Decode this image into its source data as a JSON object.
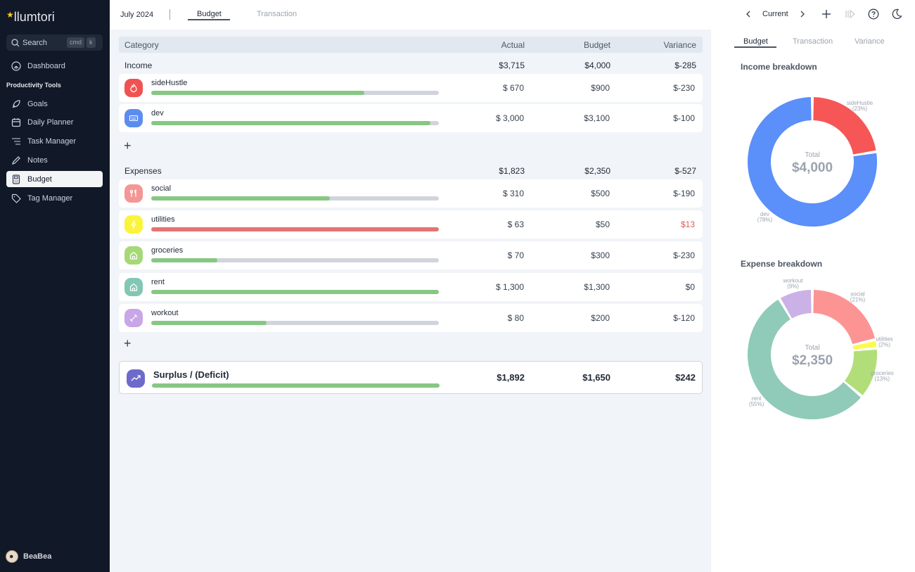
{
  "app": {
    "brand": "llumtori",
    "search": {
      "placeholder": "Search",
      "shortcut_mod": "cmd",
      "shortcut_key": "k"
    },
    "nav_top": [
      {
        "label": "Dashboard",
        "icon": "dashboard-icon"
      }
    ],
    "section_label": "Productivity Tools",
    "nav_items": [
      {
        "label": "Goals",
        "icon": "rocket-icon"
      },
      {
        "label": "Daily Planner",
        "icon": "calendar-icon"
      },
      {
        "label": "Task Manager",
        "icon": "list-icon"
      },
      {
        "label": "Notes",
        "icon": "pencil-icon"
      },
      {
        "label": "Budget",
        "icon": "calculator-icon",
        "active": true
      },
      {
        "label": "Tag Manager",
        "icon": "tag-icon"
      }
    ],
    "user": {
      "name": "BeaBea"
    }
  },
  "topbar": {
    "month": "July 2024",
    "tabs": [
      {
        "label": "Budget",
        "active": true
      },
      {
        "label": "Transaction",
        "active": false
      }
    ],
    "period": "Current",
    "icons": [
      "chevron-left-icon",
      "chevron-right-icon",
      "plus-icon",
      "panel-toggle-icon",
      "help-icon",
      "moon-icon"
    ]
  },
  "table": {
    "headers": {
      "category": "Category",
      "actual": "Actual",
      "budget": "Budget",
      "variance": "Variance"
    },
    "income": {
      "label": "Income",
      "actual": "$3,715",
      "budget": "$4,000",
      "variance": "$-285",
      "rows": [
        {
          "name": "sideHustle",
          "actual": "$ 670",
          "budget": "$900",
          "variance": "$-230",
          "progress": 0.74,
          "icon": "fire-icon",
          "color": "#f05252",
          "bar_color": "#86c784",
          "over": false
        },
        {
          "name": "dev",
          "actual": "$ 3,000",
          "budget": "$3,100",
          "variance": "$-100",
          "progress": 0.97,
          "icon": "keyboard-icon",
          "color": "#5b8def",
          "bar_color": "#86c784",
          "over": false
        }
      ]
    },
    "expenses": {
      "label": "Expenses",
      "actual": "$1,823",
      "budget": "$2,350",
      "variance": "$-527",
      "rows": [
        {
          "name": "social",
          "actual": "$ 310",
          "budget": "$500",
          "variance": "$-190",
          "progress": 0.62,
          "icon": "fork-knife-icon",
          "color": "#f59696",
          "bar_color": "#86c784",
          "over": false
        },
        {
          "name": "utilities",
          "actual": "$ 63",
          "budget": "$50",
          "variance": "$13",
          "progress": 1.0,
          "icon": "bolt-icon",
          "color": "#fbf33c",
          "bar_color": "#e57373",
          "over": true
        },
        {
          "name": "groceries",
          "actual": "$ 70",
          "budget": "$300",
          "variance": "$-230",
          "progress": 0.23,
          "icon": "home-icon",
          "color": "#a5d876",
          "bar_color": "#86c784",
          "over": false
        },
        {
          "name": "rent",
          "actual": "$ 1,300",
          "budget": "$1,300",
          "variance": "$0",
          "progress": 1.0,
          "icon": "home-icon",
          "color": "#82c7b3",
          "bar_color": "#86c784",
          "over": false
        },
        {
          "name": "workout",
          "actual": "$ 80",
          "budget": "$200",
          "variance": "$-120",
          "progress": 0.4,
          "icon": "dumbbell-icon",
          "color": "#c8a6e8",
          "bar_color": "#86c784",
          "over": false
        }
      ]
    },
    "surplus": {
      "label": "Surplus / (Deficit)",
      "actual": "$1,892",
      "budget": "$1,650",
      "variance": "$242",
      "progress": 1.0,
      "icon": "trend-up-icon",
      "color": "#6d6bc9"
    },
    "over_color": "#e05a5a"
  },
  "right_panel": {
    "tabs": [
      {
        "label": "Budget",
        "active": true
      },
      {
        "label": "Transaction",
        "active": false
      },
      {
        "label": "Variance",
        "active": false
      }
    ]
  },
  "chart_data": [
    {
      "type": "pie",
      "title": "Income breakdown",
      "center_label": "Total",
      "center_value": "$4,000",
      "slices": [
        {
          "label": "sideHustle",
          "pct_label": "(23%)",
          "value": 900,
          "color": "#f75656"
        },
        {
          "label": "dev",
          "pct_label": "(78%)",
          "value": 3100,
          "color": "#5b8ff9"
        }
      ]
    },
    {
      "type": "pie",
      "title": "Expense breakdown",
      "center_label": "Total",
      "center_value": "$2,350",
      "slices": [
        {
          "label": "social",
          "pct_label": "(21%)",
          "value": 500,
          "color": "#fd9494"
        },
        {
          "label": "utilities",
          "pct_label": "(2%)",
          "value": 50,
          "color": "#fcfa4a"
        },
        {
          "label": "groceries",
          "pct_label": "(13%)",
          "value": 300,
          "color": "#b2de7a"
        },
        {
          "label": "rent",
          "pct_label": "(55%)",
          "value": 1300,
          "color": "#8fcbb8"
        },
        {
          "label": "workout",
          "pct_label": "(9%)",
          "value": 200,
          "color": "#cbb2e6"
        }
      ]
    }
  ]
}
